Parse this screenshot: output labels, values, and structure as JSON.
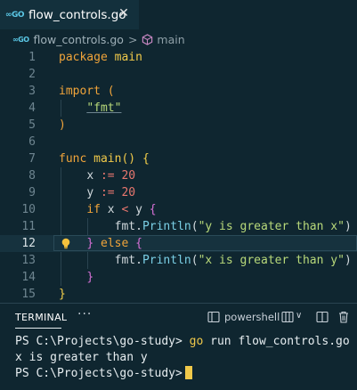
{
  "tab": {
    "badge": "∞GO",
    "title": "flow_controls.go",
    "close": "✕"
  },
  "breadcrumb": {
    "badge": "∞GO",
    "file": "flow_controls.go",
    "sep": ">",
    "symbol": "main"
  },
  "editor": {
    "active_line": 12,
    "lines": [
      {
        "n": "1"
      },
      {
        "n": "2"
      },
      {
        "n": "3"
      },
      {
        "n": "4"
      },
      {
        "n": "5"
      },
      {
        "n": "6"
      },
      {
        "n": "7"
      },
      {
        "n": "8"
      },
      {
        "n": "9"
      },
      {
        "n": "10"
      },
      {
        "n": "11"
      },
      {
        "n": "12"
      },
      {
        "n": "13"
      },
      {
        "n": "14"
      },
      {
        "n": "15"
      }
    ],
    "tokens": {
      "package": "package",
      "main": "main",
      "import": "import",
      "open_paren": "(",
      "fmt_str": "\"fmt\"",
      "close_paren": ")",
      "func": "func",
      "main_fn": "main",
      "fn_parens": "()",
      "open_brace": "{",
      "x": "x",
      "y": "y",
      "assign": ":=",
      "twenty": "20",
      "if": "if",
      "lt": "<",
      "fmt": "fmt.",
      "println": "Println",
      "str1": "\"y is greater than x\"",
      "str2": "\"x is greater than y\"",
      "close_brace": "}",
      "else": "else"
    }
  },
  "panel": {
    "terminal_tab": "TERMINAL",
    "more": "···",
    "shell": "powershell",
    "chevron": "∨"
  },
  "terminal": {
    "prompt1": "PS C:\\Projects\\go-study>",
    "cmd1": "go",
    "args1": "run flow_controls.go",
    "output": "x is greater than y",
    "prompt2": "PS C:\\Projects\\go-study>"
  }
}
